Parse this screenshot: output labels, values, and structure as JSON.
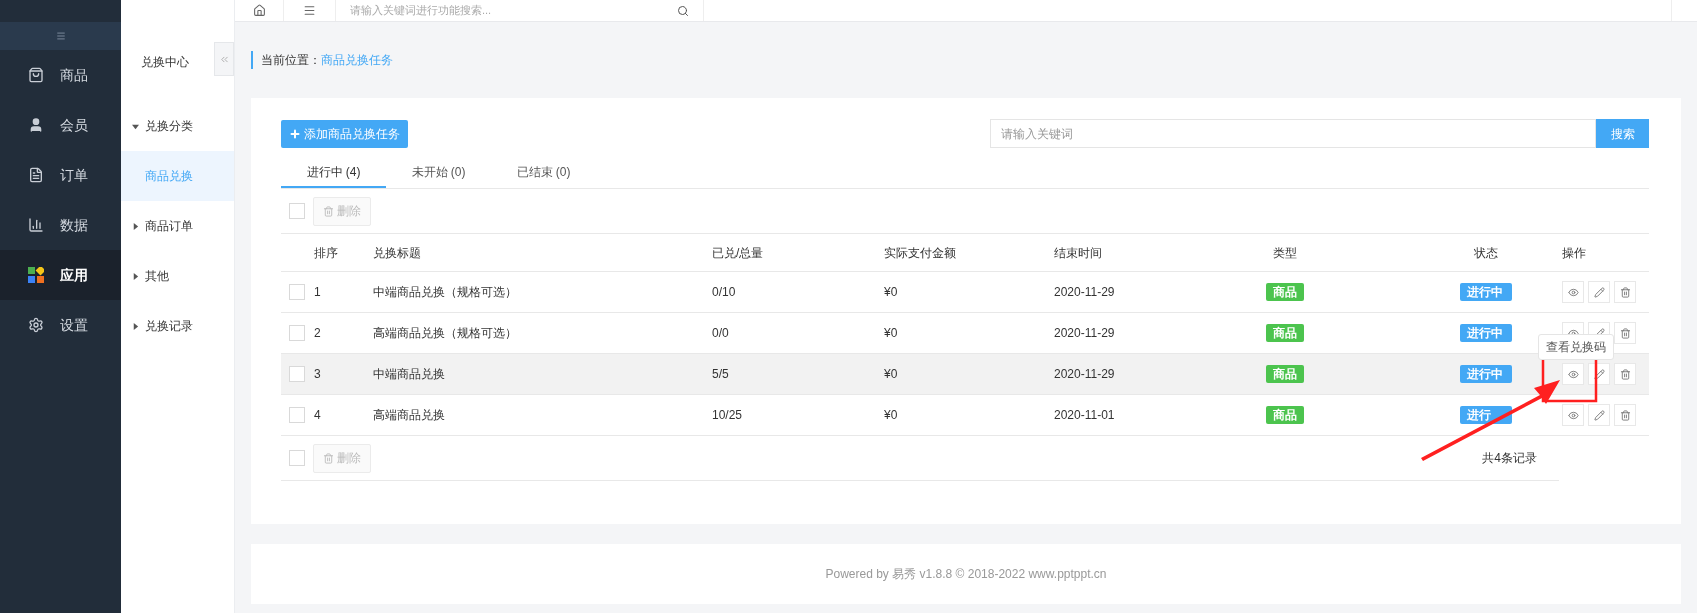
{
  "topbar": {
    "search_placeholder": "请输入关键词进行功能搜索..."
  },
  "nav": [
    {
      "label": "商品",
      "selected": false
    },
    {
      "label": "会员",
      "selected": false
    },
    {
      "label": "订单",
      "selected": false
    },
    {
      "label": "数据",
      "selected": false
    },
    {
      "label": "应用",
      "selected": true
    },
    {
      "label": "设置",
      "selected": false
    }
  ],
  "subnav": {
    "title": "兑换中心",
    "items": [
      {
        "label": "兑换分类",
        "expanded": true,
        "selected": false,
        "children": [
          {
            "label": "商品兑换",
            "selected": true
          }
        ]
      },
      {
        "label": "商品订单",
        "expanded": false,
        "selected": false
      },
      {
        "label": "其他",
        "expanded": false,
        "selected": false
      },
      {
        "label": "兑换记录",
        "expanded": false,
        "selected": false
      }
    ]
  },
  "breadcrumb": {
    "label": "当前位置：",
    "current": "商品兑换任务"
  },
  "add_button": "添加商品兑换任务",
  "search": {
    "placeholder": "请输入关键词",
    "button": "搜索"
  },
  "tabs": [
    {
      "label": "进行中 (4)",
      "selected": true
    },
    {
      "label": "未开始 (0)",
      "selected": false
    },
    {
      "label": "已结束 (0)",
      "selected": false
    }
  ],
  "select_all_checked": false,
  "delete_button": "删除",
  "table": {
    "columns": [
      "排序",
      "兑换标题",
      "已兑/总量",
      "实际支付金额",
      "结束时间",
      "类型",
      "状态",
      "操作"
    ],
    "rows": [
      {
        "index": "1",
        "title": "中端商品兑换（规格可选）",
        "ratio": "0/10",
        "amount": "¥0",
        "end": "2020-11-29",
        "type": "商品",
        "status": "进行中",
        "checked": false,
        "hovered": false
      },
      {
        "index": "2",
        "title": "高端商品兑换（规格可选）",
        "ratio": "0/0",
        "amount": "¥0",
        "end": "2020-11-29",
        "type": "商品",
        "status": "进行中",
        "checked": false,
        "hovered": false
      },
      {
        "index": "3",
        "title": "中端商品兑换",
        "ratio": "5/5",
        "amount": "¥0",
        "end": "2020-11-29",
        "type": "商品",
        "status": "进行中",
        "checked": false,
        "hovered": true,
        "tooltip": "查看兑换码"
      },
      {
        "index": "4",
        "title": "高端商品兑换",
        "ratio": "10/25",
        "amount": "¥0",
        "end": "2020-11-01",
        "type": "商品",
        "status": "进行",
        "checked": false,
        "hovered": false
      }
    ]
  },
  "bottom_select_all_checked": false,
  "bottom_delete_button": "删除",
  "total": "共4条记录",
  "footer": "Powered by 易秀 v1.8.8 © 2018-2022 www.pptppt.cn"
}
